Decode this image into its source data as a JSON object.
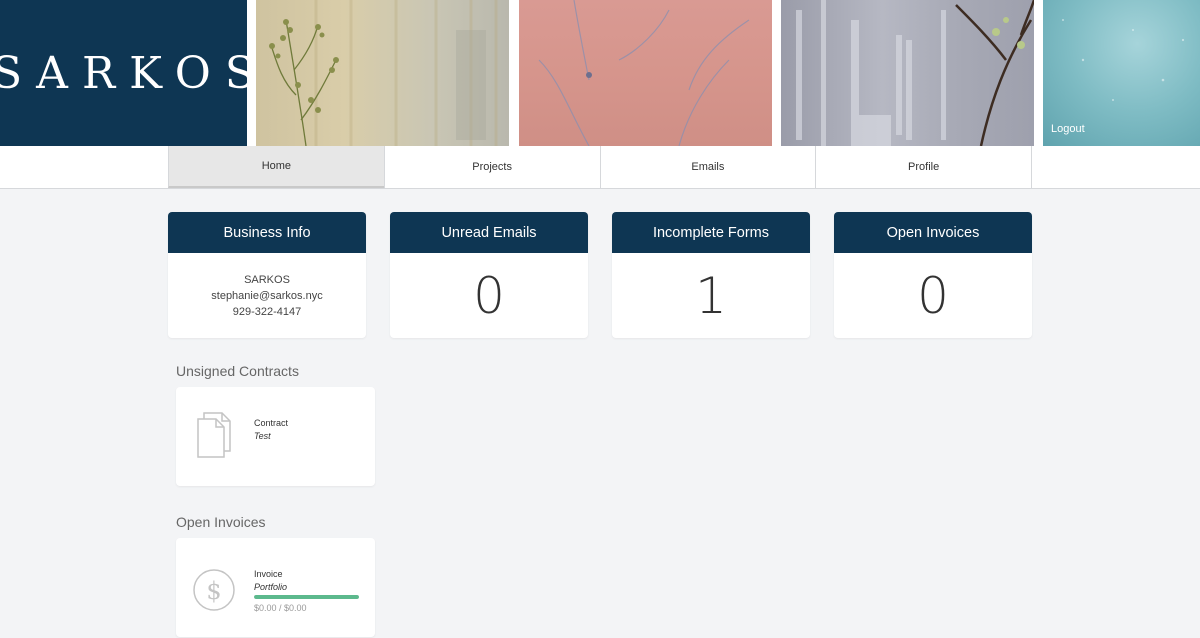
{
  "header": {
    "logo": "SARKOS",
    "logout_label": "Logout"
  },
  "nav": {
    "tabs": [
      {
        "label": "Home",
        "active": true
      },
      {
        "label": "Projects"
      },
      {
        "label": "Emails"
      },
      {
        "label": "Profile"
      }
    ]
  },
  "stats": {
    "business_info": {
      "title": "Business Info",
      "name": "SARKOS",
      "email": "stephanie@sarkos.nyc",
      "phone": "929-322-4147"
    },
    "unread_emails": {
      "title": "Unread Emails",
      "value": "0"
    },
    "incomplete_forms": {
      "title": "Incomplete Forms",
      "value": "1"
    },
    "open_invoices": {
      "title": "Open Invoices",
      "value": "0"
    }
  },
  "unsigned_contracts": {
    "title": "Unsigned Contracts",
    "items": [
      {
        "type": "Contract",
        "name": "Test",
        "icon": "document-icon"
      }
    ]
  },
  "open_invoices_section": {
    "title": "Open Invoices",
    "items": [
      {
        "type": "Invoice",
        "name": "Portfolio",
        "paid_fraction": 1.0,
        "amount": "$0.00 / $0.00",
        "icon": "dollar-icon"
      }
    ]
  },
  "colors": {
    "brand_navy": "#0e3653",
    "progress_green": "#5cb98d",
    "page_bg": "#f3f4f6"
  }
}
